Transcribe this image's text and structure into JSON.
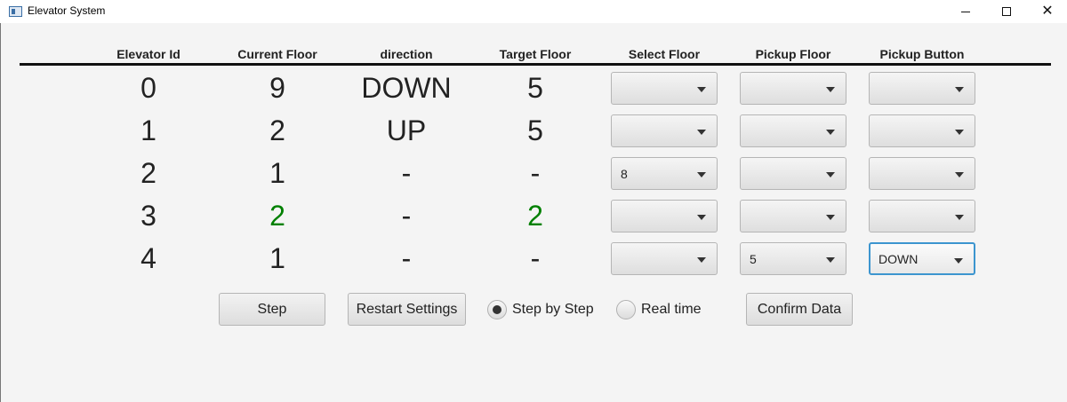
{
  "window": {
    "title": "Elevator System"
  },
  "columns": [
    "Elevator Id",
    "Current Floor",
    "direction",
    "Target Floor",
    "Select Floor",
    "Pickup Floor",
    "Pickup Button"
  ],
  "rows": [
    {
      "id": "0",
      "current": "9",
      "direction": "DOWN",
      "target": "5",
      "select": "",
      "pickup_floor": "",
      "pickup_button": ""
    },
    {
      "id": "1",
      "current": "2",
      "direction": "UP",
      "target": "5",
      "select": "",
      "pickup_floor": "",
      "pickup_button": ""
    },
    {
      "id": "2",
      "current": "1",
      "direction": "-",
      "target": "-",
      "select": "8",
      "pickup_floor": "",
      "pickup_button": ""
    },
    {
      "id": "3",
      "current": "2",
      "direction": "-",
      "target": "2",
      "select": "",
      "pickup_floor": "",
      "pickup_button": ""
    },
    {
      "id": "4",
      "current": "1",
      "direction": "-",
      "target": "-",
      "select": "",
      "pickup_floor": "5",
      "pickup_button": "DOWN"
    }
  ],
  "controls": {
    "step": "Step",
    "restart": "Restart Settings",
    "radio_step": "Step by Step",
    "radio_real": "Real time",
    "confirm": "Confirm Data",
    "mode_selected": "Step by Step"
  },
  "colors": {
    "highlight_green": "#008000",
    "focus_blue": "#3c95cf"
  }
}
